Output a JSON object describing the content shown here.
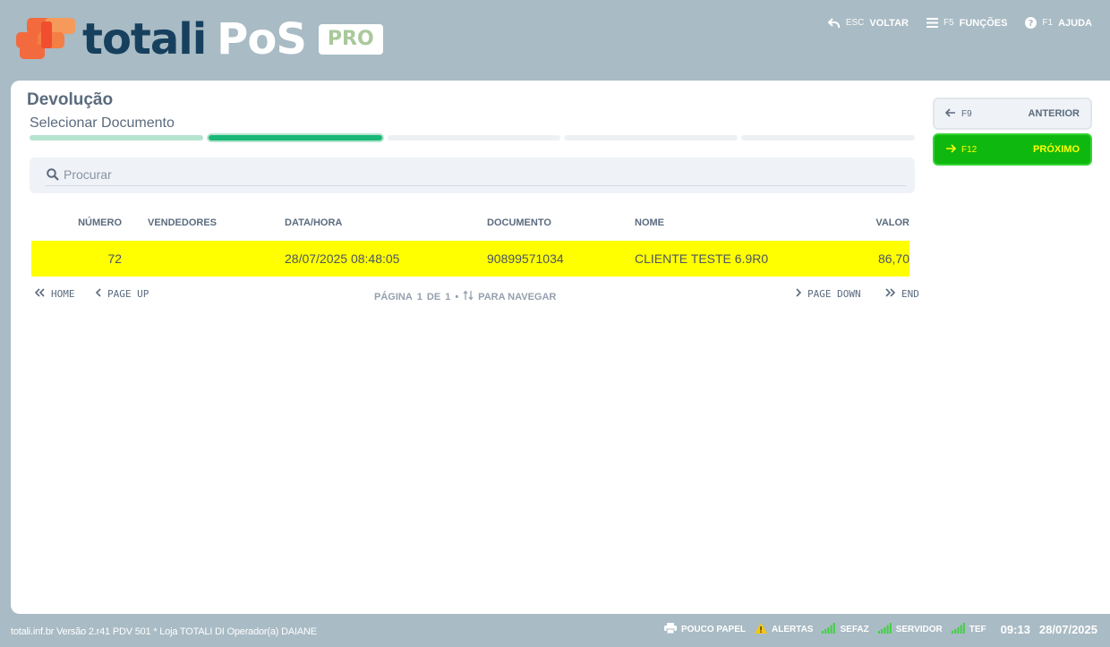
{
  "header": {
    "logo_totali": "totali",
    "logo_pos": "PoS",
    "logo_pro": "PRO",
    "actions": [
      {
        "key": "ESC",
        "label": "VOLTAR",
        "icon": "undo-icon"
      },
      {
        "key": "F5",
        "label": "FUNÇÕES",
        "icon": "menu-icon"
      },
      {
        "key": "F1",
        "label": "AJUDA",
        "icon": "help-icon"
      }
    ]
  },
  "page": {
    "title": "Devolução",
    "step_title": "Selecionar Documento",
    "steps_total": 5,
    "current_step": 2
  },
  "search": {
    "placeholder": "Procurar",
    "value": ""
  },
  "table": {
    "columns": [
      "NÚMERO",
      "VENDEDORES",
      "DATA/HORA",
      "DOCUMENTO",
      "NOME",
      "VALOR"
    ],
    "rows": [
      {
        "numero": "72",
        "vendedores": "",
        "data_hora": "28/07/2025 08:48:05",
        "documento": "90899571034",
        "nome": "CLIENTE TESTE 6.9R0",
        "valor": "86,70"
      }
    ]
  },
  "pager": {
    "home": "HOME",
    "page_up": "PAGE UP",
    "page_word": "PÁGINA",
    "page_current": "1",
    "page_of": "DE",
    "page_total": "1",
    "sep": "•",
    "nav_hint": "PARA NAVEGAR",
    "page_down": "PAGE DOWN",
    "end": "END"
  },
  "side": {
    "prev": {
      "key": "F9",
      "label": "ANTERIOR"
    },
    "next": {
      "key": "F12",
      "label": "PRÓXIMO"
    }
  },
  "footer": {
    "info": "totali.inf.br Versão 2.r41 PDV 501  *  Loja TOTALI DI Operador(a) DAIANE",
    "statuses": [
      {
        "label": "POUCO PAPEL",
        "icon": "printer-icon"
      },
      {
        "label": "ALERTAS",
        "icon": "warning-icon"
      },
      {
        "label": "SEFAZ",
        "icon": "signal-icon"
      },
      {
        "label": "SERVIDOR",
        "icon": "signal-icon"
      },
      {
        "label": "TEF",
        "icon": "signal-icon"
      }
    ],
    "time": "09:13",
    "date": "28/07/2025"
  },
  "colors": {
    "background": "#a9bbc4",
    "brand_dark": "#16405e",
    "brand_orange": "#f26a3d",
    "selected_row": "#ffff00",
    "next_button": "#0fb80f",
    "step_active": "#19b776",
    "signal_green": "#3fd13f",
    "warning_yellow": "#f5c518"
  }
}
